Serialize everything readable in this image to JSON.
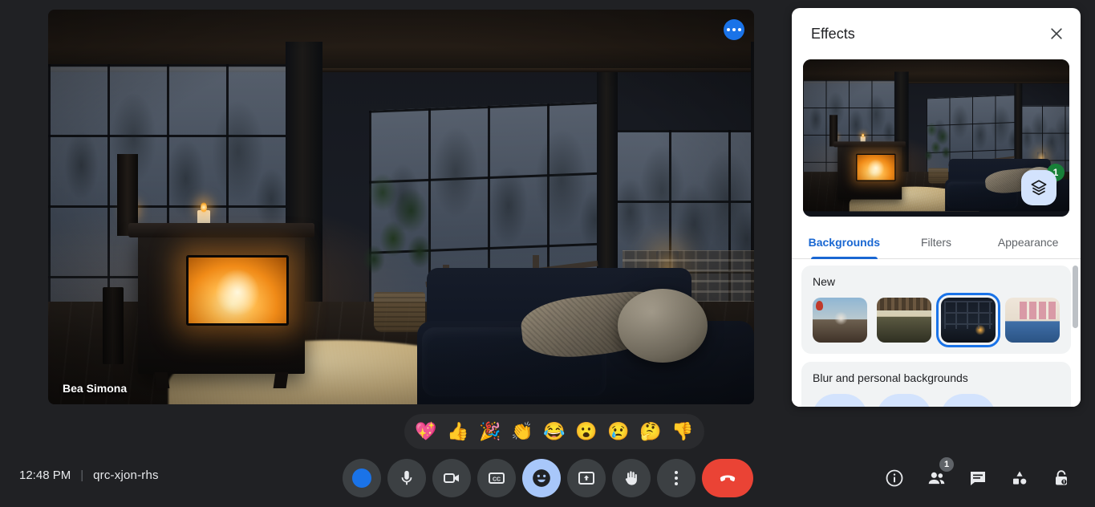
{
  "meeting": {
    "time": "12:48 PM",
    "separator": "|",
    "code": "qrc-xjon-rhs",
    "participant_name": "Bea Simona"
  },
  "video_tile": {
    "more_options_icon": "more-horizontal-icon",
    "scene_description": "Dark cabin living room with wood stove fire, large grid windows, misty forest outside, shag rug and navy sofa"
  },
  "reactions": {
    "items": [
      {
        "name": "sparkling-heart",
        "glyph": "💖"
      },
      {
        "name": "thumbs-up",
        "glyph": "👍"
      },
      {
        "name": "party-popper",
        "glyph": "🎉"
      },
      {
        "name": "clapping-hands",
        "glyph": "👏"
      },
      {
        "name": "face-with-tears-of-joy",
        "glyph": "😂"
      },
      {
        "name": "face-with-open-mouth",
        "glyph": "😮"
      },
      {
        "name": "crying-face",
        "glyph": "😢"
      },
      {
        "name": "thinking-face",
        "glyph": "🤔"
      },
      {
        "name": "thumbs-down",
        "glyph": "👎"
      }
    ]
  },
  "controls": {
    "items": [
      {
        "name": "visual-effects-button",
        "icon": "blue-dot-icon",
        "active": false
      },
      {
        "name": "microphone-button",
        "icon": "microphone-icon",
        "active": false
      },
      {
        "name": "camera-button",
        "icon": "video-camera-icon",
        "active": false
      },
      {
        "name": "captions-button",
        "icon": "closed-captions-icon",
        "active": false
      },
      {
        "name": "reactions-button",
        "icon": "emoji-smile-icon",
        "active": true
      },
      {
        "name": "present-screen-button",
        "icon": "present-screen-icon",
        "active": false
      },
      {
        "name": "raise-hand-button",
        "icon": "raised-hand-icon",
        "active": false
      },
      {
        "name": "more-options-button",
        "icon": "more-vertical-icon",
        "active": false
      },
      {
        "name": "leave-call-button",
        "icon": "phone-hangup-icon",
        "active": false
      }
    ]
  },
  "right_icons": {
    "items": [
      {
        "name": "meeting-details-button",
        "icon": "info-icon",
        "badge": ""
      },
      {
        "name": "people-button",
        "icon": "people-icon",
        "badge": "1"
      },
      {
        "name": "chat-button",
        "icon": "chat-bubble-icon",
        "badge": ""
      },
      {
        "name": "activities-button",
        "icon": "activities-shapes-icon",
        "badge": ""
      },
      {
        "name": "host-controls-button",
        "icon": "lock-shield-icon",
        "badge": ""
      }
    ]
  },
  "effects_panel": {
    "title": "Effects",
    "close_icon": "close-icon",
    "preview": {
      "layers_icon": "layers-icon",
      "layers_badge": "1"
    },
    "tabs": [
      {
        "label": "Backgrounds",
        "selected": true
      },
      {
        "label": "Filters",
        "selected": false
      },
      {
        "label": "Appearance",
        "selected": false
      }
    ],
    "sections": [
      {
        "title": "New",
        "thumbnails": [
          {
            "name": "background-taj-mahal",
            "art": "t1",
            "selected": false
          },
          {
            "name": "background-pergola-terrace",
            "art": "t2",
            "selected": false
          },
          {
            "name": "background-cabin-fireplace",
            "art": "t3",
            "selected": true
          },
          {
            "name": "background-gallery-living-room",
            "art": "t4",
            "selected": false
          }
        ]
      },
      {
        "title": "Blur and personal backgrounds",
        "blur_buttons": [
          "blur-slight-button",
          "blur-full-button",
          "personal-background-button"
        ]
      }
    ]
  },
  "colors": {
    "accent_blue": "#1a73e8",
    "tab_blue": "#1967d2",
    "active_chip": "#a8c7fa",
    "badge_green": "#188038",
    "hangup_red": "#ea4335",
    "bar_dark": "#202124",
    "control_grey": "#3c4043"
  }
}
